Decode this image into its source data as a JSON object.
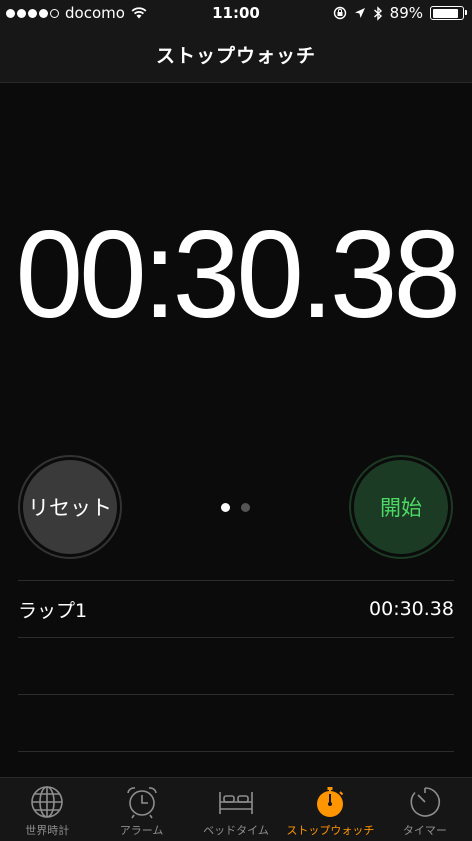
{
  "status_bar": {
    "carrier": "docomo",
    "signal_dots_filled": 4,
    "signal_dots_total": 5,
    "time": "11:00",
    "battery_percent": "89%",
    "battery_level": 0.89
  },
  "nav": {
    "title": "ストップウォッチ"
  },
  "timer": {
    "display": "00:30.38"
  },
  "controls": {
    "reset_label": "リセット",
    "start_label": "開始",
    "page_count": 2,
    "active_page": 0
  },
  "laps": [
    {
      "label": "ラップ1",
      "time": "00:30.38"
    }
  ],
  "tabs": [
    {
      "label": "世界時計",
      "icon": "globe-icon",
      "active": false
    },
    {
      "label": "アラーム",
      "icon": "alarm-clock-icon",
      "active": false
    },
    {
      "label": "ベッドタイム",
      "icon": "bed-icon",
      "active": false
    },
    {
      "label": "ストップウォッチ",
      "icon": "stopwatch-icon",
      "active": true
    },
    {
      "label": "タイマー",
      "icon": "timer-icon",
      "active": false
    }
  ],
  "colors": {
    "accent": "#ff9500",
    "start_text": "#4cd964",
    "start_bg": "#1c3b24",
    "reset_bg": "#3a3a3a",
    "background": "#0b0b0b"
  }
}
